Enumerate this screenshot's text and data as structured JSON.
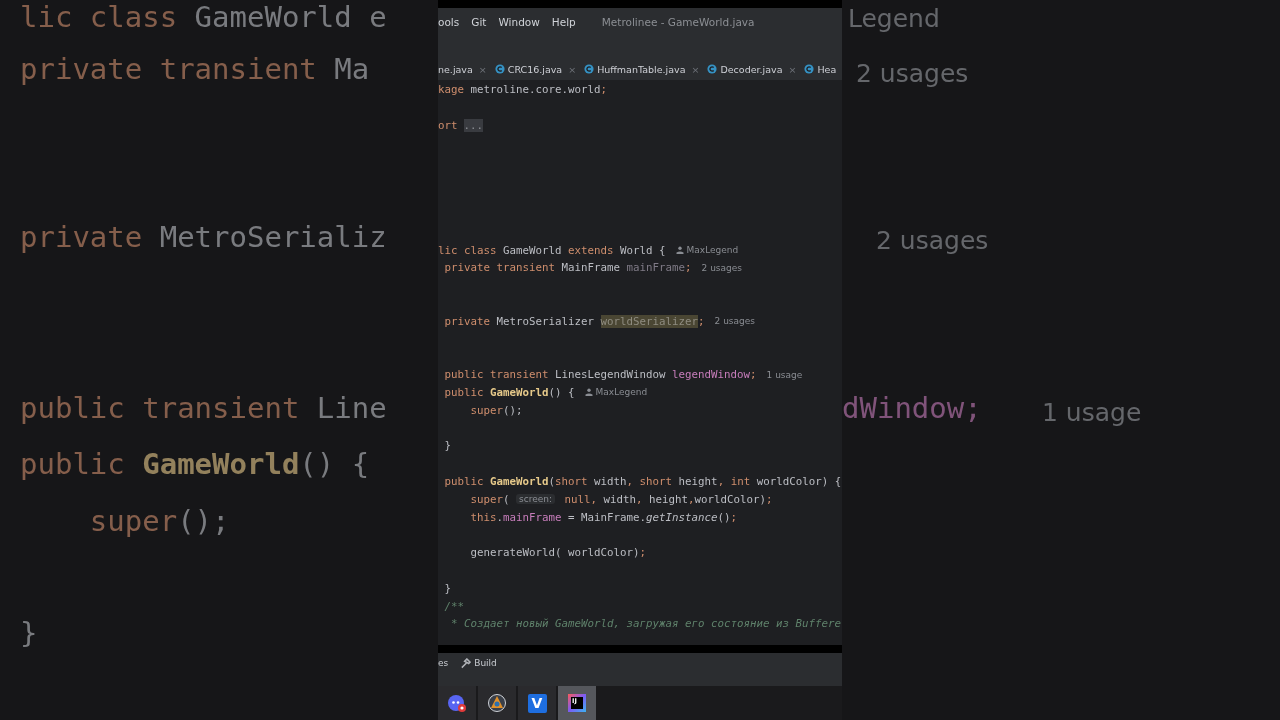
{
  "backdrop": {
    "left": [
      [
        {
          "text": "lic class ",
          "kind": "kw"
        },
        {
          "text": "GameWorld e",
          "kind": "plain"
        }
      ],
      [
        {
          "text": "private transient ",
          "kind": "kw"
        },
        {
          "text": "Ma",
          "kind": "plain"
        }
      ],
      [
        {
          "text": "private ",
          "kind": "kw"
        },
        {
          "text": "MetroSerializ",
          "kind": "plain"
        }
      ],
      [
        {
          "text": "public transient ",
          "kind": "kw"
        },
        {
          "text": "Line",
          "kind": "plain"
        }
      ],
      [
        {
          "text": "public ",
          "kind": "kw"
        },
        {
          "text": "GameWorld",
          "kind": "decl"
        },
        {
          "text": "() {",
          "kind": "plain"
        }
      ],
      [
        {
          "text": "    super",
          "kind": "kw"
        },
        {
          "text": "();",
          "kind": "plain"
        }
      ],
      [
        {
          "text": "}",
          "kind": "plain"
        }
      ]
    ],
    "right": [
      [
        {
          "text": "Legend",
          "kind": "usages"
        }
      ],
      [
        {
          "text": "2 usages",
          "kind": "usages"
        }
      ],
      [
        {
          "text": "2 usages",
          "kind": "usages"
        }
      ],
      [
        {
          "text": "dWindow;",
          "kind": "field"
        }
      ],
      [
        {
          "text": "1 usage",
          "kind": "usages"
        }
      ]
    ]
  },
  "window": {
    "menu": [
      "ools",
      "Git",
      "Window",
      "Help"
    ],
    "title": "Metrolinee - GameWorld.java"
  },
  "tabs": [
    {
      "label": "ne.java",
      "icon": false,
      "close": "×"
    },
    {
      "label": "CRC16.java",
      "icon": true,
      "close": "×"
    },
    {
      "label": "HuffmanTable.java",
      "icon": true,
      "close": "×"
    },
    {
      "label": "Decoder.java",
      "icon": true,
      "close": "×"
    },
    {
      "label": "Hea",
      "icon": true
    }
  ],
  "code": [
    [
      {
        "text": "kage",
        "kind": "kw"
      },
      {
        "text": " metroline.core.world",
        "kind": "plain"
      },
      {
        "text": ";",
        "kind": "kw"
      }
    ],
    [
      {
        "text": "ort",
        "kind": "kw"
      },
      {
        "text": "...",
        "kind": "fold"
      }
    ],
    [
      {
        "text": "lic class ",
        "kind": "kw"
      },
      {
        "text": "GameWorld ",
        "kind": "plain"
      },
      {
        "text": "extends ",
        "kind": "kw"
      },
      {
        "text": "World {",
        "kind": "plain"
      },
      {
        "text": "MaxLegend",
        "kind": "author"
      }
    ],
    [
      {
        "text": " private transient ",
        "kind": "kw"
      },
      {
        "text": "MainFrame ",
        "kind": "plain"
      },
      {
        "text": "mainFrame",
        "kind": "muted"
      },
      {
        "text": ";",
        "kind": "kw"
      },
      {
        "text": "2 usages",
        "kind": "usages"
      }
    ],
    [
      {
        "text": " private ",
        "kind": "kw"
      },
      {
        "text": "MetroSerializer ",
        "kind": "plain"
      },
      {
        "text": "worldSerializer",
        "kind": "match"
      },
      {
        "text": ";",
        "kind": "kw"
      },
      {
        "text": "2 usages",
        "kind": "usages"
      }
    ],
    [
      {
        "text": " public transient ",
        "kind": "kw"
      },
      {
        "text": "LinesLegendWindow ",
        "kind": "plain"
      },
      {
        "text": "legendWindow",
        "kind": "field"
      },
      {
        "text": ";",
        "kind": "kw"
      },
      {
        "text": "1 usage",
        "kind": "usages"
      }
    ],
    [
      {
        "text": " public ",
        "kind": "kw"
      },
      {
        "text": "GameWorld",
        "kind": "decl"
      },
      {
        "text": "() {",
        "kind": "plain"
      },
      {
        "text": "MaxLegend",
        "kind": "author"
      }
    ],
    [
      {
        "text": "     super",
        "kind": "kw"
      },
      {
        "text": "();",
        "kind": "plain"
      }
    ],
    [
      {
        "text": " }",
        "kind": "plain"
      }
    ],
    [
      {
        "text": " public ",
        "kind": "kw"
      },
      {
        "text": "GameWorld",
        "kind": "decl"
      },
      {
        "text": "(",
        "kind": "plain"
      },
      {
        "text": "short ",
        "kind": "kw"
      },
      {
        "text": "width",
        "kind": "plain"
      },
      {
        "text": ", ",
        "kind": "kw"
      },
      {
        "text": "short ",
        "kind": "kw"
      },
      {
        "text": "height",
        "kind": "plain"
      },
      {
        "text": ", ",
        "kind": "kw"
      },
      {
        "text": "int ",
        "kind": "kw"
      },
      {
        "text": "worldColor) {",
        "kind": "plain"
      }
    ],
    [
      {
        "text": "     super",
        "kind": "kw"
      },
      {
        "text": "( ",
        "kind": "plain"
      },
      {
        "text": "screen:",
        "kind": "param"
      },
      {
        "text": " null",
        "kind": "kw"
      },
      {
        "text": ", ",
        "kind": "kw"
      },
      {
        "text": "width",
        "kind": "plain"
      },
      {
        "text": ", ",
        "kind": "kw"
      },
      {
        "text": "height",
        "kind": "plain"
      },
      {
        "text": ",",
        "kind": "kw"
      },
      {
        "text": "worldColor)",
        "kind": "plain"
      },
      {
        "text": ";",
        "kind": "kw"
      }
    ],
    [
      {
        "text": "     this",
        "kind": "kw"
      },
      {
        "text": ".",
        "kind": "plain"
      },
      {
        "text": "mainFrame",
        "kind": "field"
      },
      {
        "text": " = MainFrame.",
        "kind": "plain"
      },
      {
        "text": "getInstance",
        "kind": "italic"
      },
      {
        "text": "()",
        "kind": "plain"
      },
      {
        "text": ";",
        "kind": "kw"
      }
    ],
    [
      {
        "text": "     generateWorld( worldColor)",
        "kind": "plain"
      },
      {
        "text": ";",
        "kind": "kw"
      }
    ],
    [
      {
        "text": " }",
        "kind": "plain"
      }
    ],
    [
      {
        "text": " /**",
        "kind": "comment"
      }
    ],
    [
      {
        "text": "  * Создает новый GameWorld, загружая его состояние из Buffere",
        "kind": "comment"
      }
    ]
  ],
  "bottom_tabs": [
    {
      "label": "es",
      "icon": false
    },
    {
      "label": "Build",
      "icon": true
    }
  ],
  "taskbar": [
    {
      "kind": "chat",
      "selected": false
    },
    {
      "kind": "orb",
      "selected": false
    },
    {
      "kind": "letter",
      "label": "V",
      "selected": false
    },
    {
      "kind": "ide",
      "label": "IJ",
      "selected": true
    }
  ]
}
